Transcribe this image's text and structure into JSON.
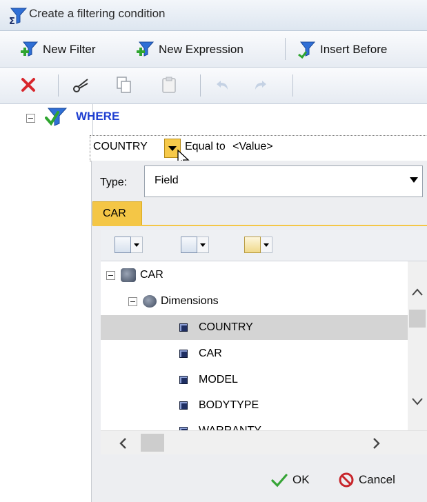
{
  "title": "Create a filtering condition",
  "toolbar1": {
    "new_filter": "New Filter",
    "new_expression": "New Expression",
    "insert_before": "Insert Before"
  },
  "tree_root": "WHERE",
  "condition": {
    "field": "COUNTRY",
    "operator": "Equal to",
    "value": "<Value>"
  },
  "type": {
    "label": "Type:",
    "value": "Field"
  },
  "tab": "CAR",
  "field_tree": {
    "root": "CAR",
    "group": "Dimensions",
    "items": [
      "COUNTRY",
      "CAR",
      "MODEL",
      "BODYTYPE",
      "WARRANTY"
    ],
    "selected": "COUNTRY"
  },
  "footer": {
    "ok": "OK",
    "cancel": "Cancel"
  },
  "colors": {
    "accent_yellow": "#f4c646",
    "where_blue": "#1f3fd1",
    "selection_gray": "#d4d4d4"
  }
}
